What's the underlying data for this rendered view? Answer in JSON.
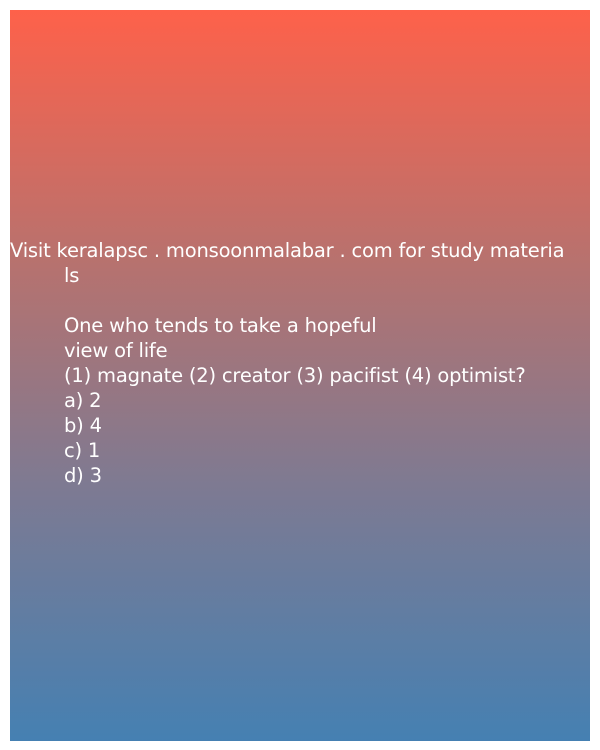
{
  "banner": {
    "line1": "Visit keralapsc . monsoonmalabar . com for study materia",
    "line2": "ls"
  },
  "question": {
    "line1": "One who tends to take a hopeful",
    "line2": "view of life",
    "line3": "(1) magnate (2) creator (3) pacifist (4) optimist?"
  },
  "options": [
    "a) 2",
    "b) 4",
    "c) 1",
    "d) 3"
  ],
  "colors": {
    "gradient_top": "#fe614a",
    "gradient_bottom": "#4580b2",
    "text": "#ffffff"
  }
}
